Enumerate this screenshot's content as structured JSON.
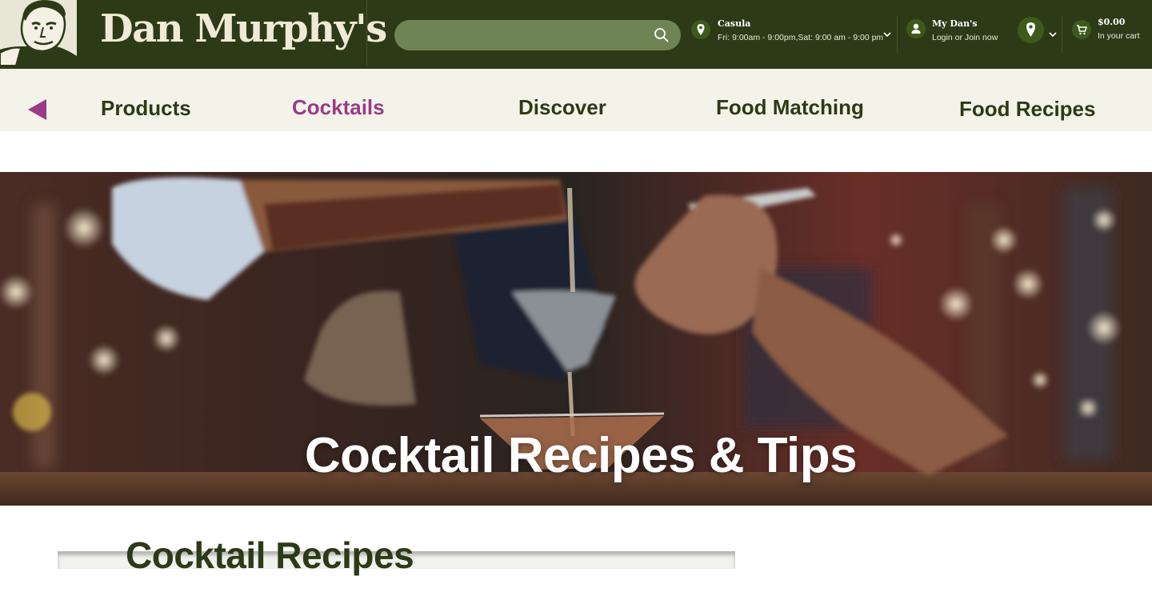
{
  "header": {
    "brand": "Dan Murphy's",
    "search": {
      "value": "",
      "placeholder": ""
    },
    "store": {
      "name": "Casula",
      "hours": "Fri: 9:00am - 9:00pm,Sat: 9:00 am - 9:00 pm"
    },
    "account": {
      "title": "My Dan's",
      "subtitle": "Login or Join now"
    },
    "cart": {
      "total": "$0.00",
      "subtitle": "In your cart"
    }
  },
  "nav": {
    "items": [
      {
        "label": "Products",
        "active": false
      },
      {
        "label": "Cocktails",
        "active": true
      },
      {
        "label": "Discover",
        "active": false
      },
      {
        "label": "Food Matching",
        "active": false
      },
      {
        "label": "Food Recipes",
        "active": false
      }
    ]
  },
  "hero": {
    "title": "Cocktail Recipes & Tips"
  },
  "section": {
    "title": "Cocktail Recipes"
  },
  "colors": {
    "header_bg": "#2d3a17",
    "nav_bg": "#f3f3ea",
    "accent": "#9b3b87",
    "search_bg": "#6f8455"
  }
}
